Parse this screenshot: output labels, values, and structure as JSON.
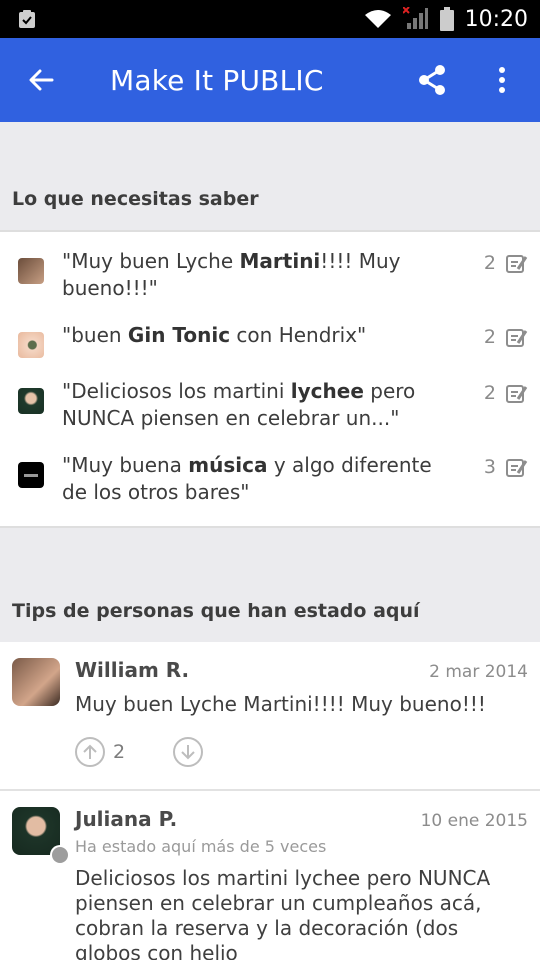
{
  "status": {
    "time": "10:20"
  },
  "appbar": {
    "title": "Make It PUBLIC"
  },
  "need_section": {
    "heading": "Lo que necesitas saber",
    "items": [
      {
        "pre": "\"Muy buen Lyche ",
        "bold": "Martini",
        "post": "!!!! Muy bueno!!!\"",
        "count": "2"
      },
      {
        "pre": "\"buen ",
        "bold": "Gin Tonic",
        "post": " con Hendrix\"",
        "count": "2"
      },
      {
        "pre": "\"Deliciosos los martini ",
        "bold": "lychee",
        "post": " pero NUNCA piensen en celebrar un...\"",
        "count": "2"
      },
      {
        "pre": "\"Muy buena ",
        "bold": "música",
        "post": " y algo diferente de los otros bares\"",
        "count": "3"
      }
    ]
  },
  "tips_section": {
    "heading": "Tips de personas que han estado aquí",
    "tips": [
      {
        "author": "William R.",
        "date": "2 mar 2014",
        "text": "Muy buen Lyche Martini!!!! Muy bueno!!!",
        "upvotes": "2"
      },
      {
        "author": "Juliana P.",
        "date": "10 ene 2015",
        "subtitle": "Ha estado aquí más de 5 veces",
        "text": "Deliciosos los martini lychee pero NUNCA piensen en celebrar un cumpleaños acá, cobran la reserva y la decoración (dos globos con helio"
      }
    ]
  },
  "colors": {
    "appbar": "#3061e0",
    "background": "#ebebee"
  }
}
